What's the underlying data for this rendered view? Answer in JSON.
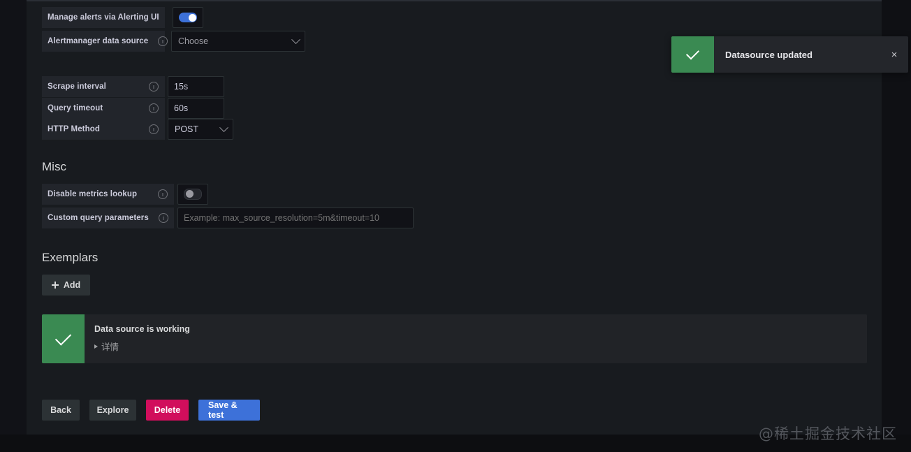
{
  "settings": {
    "alerting": {
      "manage_alerts_label": "Manage alerts via Alerting UI",
      "manage_alerts_toggle": "on",
      "alertmanager_label": "Alertmanager data source",
      "alertmanager_value": "Choose"
    },
    "intervals": {
      "scrape_interval_label": "Scrape interval",
      "scrape_interval_value": "15s",
      "query_timeout_label": "Query timeout",
      "query_timeout_value": "60s",
      "http_method_label": "HTTP Method",
      "http_method_value": "POST"
    },
    "misc": {
      "heading": "Misc",
      "disable_metrics_lookup_label": "Disable metrics lookup",
      "disable_metrics_lookup_toggle": "off",
      "custom_query_params_label": "Custom query parameters",
      "custom_query_params_placeholder": "Example: max_source_resolution=5m&timeout=10",
      "custom_query_params_value": ""
    },
    "exemplars": {
      "heading": "Exemplars",
      "add_label": "Add"
    }
  },
  "test_result": {
    "title": "Data source is working",
    "details_label": "详情",
    "icon": "check-icon",
    "color": "#3a8a52"
  },
  "actions": {
    "back": "Back",
    "explore": "Explore",
    "delete": "Delete",
    "save_and_test": "Save & test",
    "delete_color": "#d10e5c",
    "primary_color": "#3d71d9"
  },
  "toast": {
    "message": "Datasource updated",
    "icon": "check-icon",
    "close_icon": "×",
    "color": "#3a8a52"
  },
  "watermark": {
    "text": "@稀土掘金技术社区"
  }
}
